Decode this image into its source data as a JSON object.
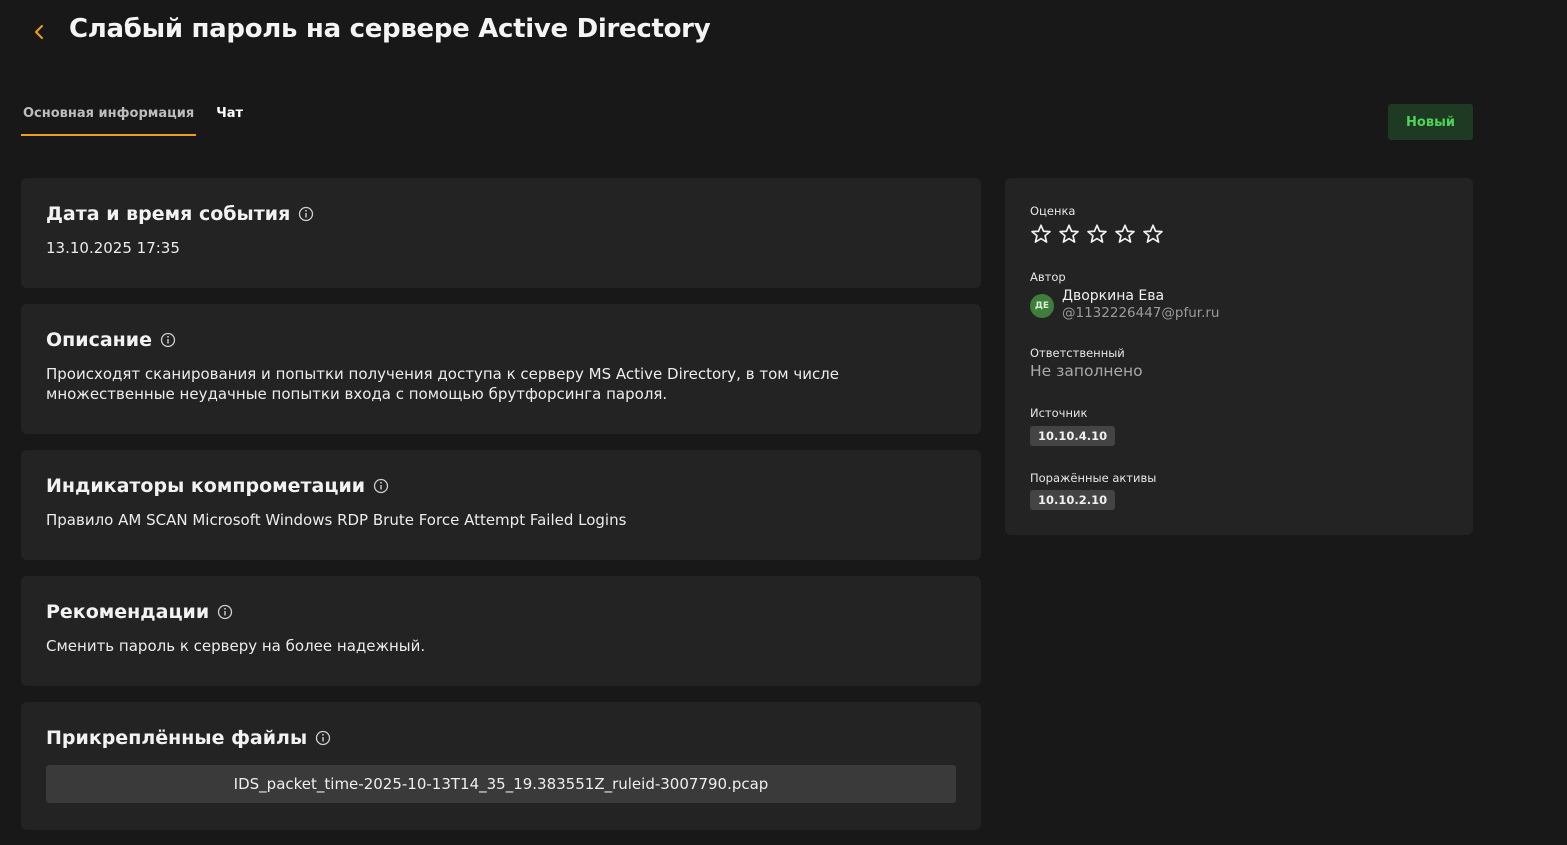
{
  "header": {
    "title": "Слабый пароль на сервере Active Directory"
  },
  "tabs": [
    {
      "label": "Основная информация",
      "active": true
    },
    {
      "label": "Чат",
      "active": false
    }
  ],
  "status": {
    "label": "Новый",
    "color": "#4fd35a"
  },
  "accent_color": "#f29d1c",
  "sections": {
    "datetime": {
      "title": "Дата и время события",
      "value": "13.10.2025 17:35"
    },
    "description": {
      "title": "Описание",
      "value": "Происходят сканирования и попытки получения доступа к серверу MS Active Directory, в том числе множественные неудачные попытки входа с помощью брутфорсинга пароля."
    },
    "indicators": {
      "title": "Индикаторы компрометации",
      "value": "Правило AM SCAN Microsoft Windows RDP Brute Force Attempt Failed Logins"
    },
    "recommendations": {
      "title": "Рекомендации",
      "value": "Сменить пароль к серверу на более надежный."
    },
    "files": {
      "title": "Прикреплённые файлы",
      "items": [
        "IDS_packet_time-2025-10-13T14_35_19.383551Z_ruleid-3007790.pcap"
      ]
    }
  },
  "sidebar": {
    "rating": {
      "label": "Оценка",
      "value": 0,
      "max": 5
    },
    "author": {
      "label": "Автор",
      "initials": "ДЕ",
      "name": "Дворкина Ева",
      "email": "@1132226447@pfur.ru"
    },
    "responsible": {
      "label": "Ответственный",
      "value": "Не заполнено"
    },
    "source": {
      "label": "Источник",
      "value": "10.10.4.10"
    },
    "affected": {
      "label": "Поражённые активы",
      "value": "10.10.2.10"
    }
  }
}
